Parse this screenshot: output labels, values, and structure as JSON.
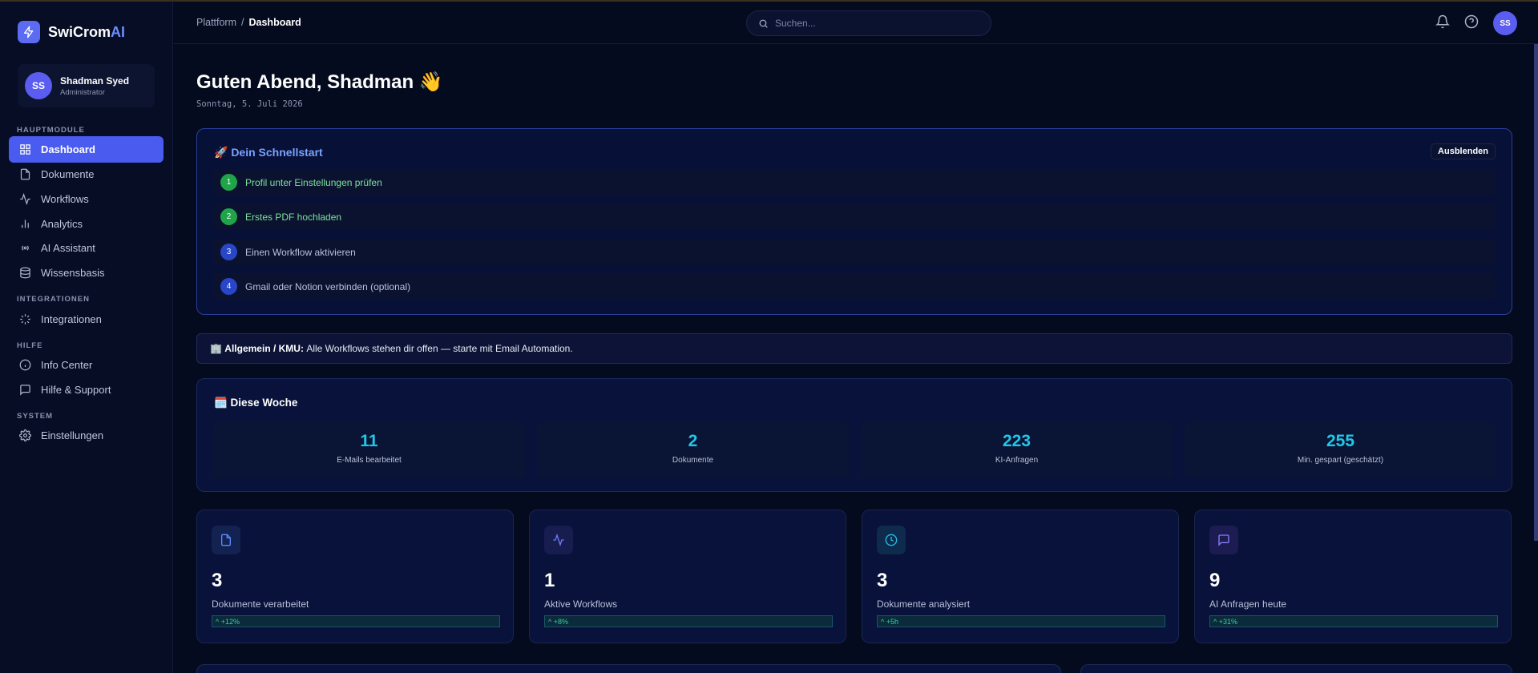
{
  "brand": {
    "name_main": "SwiCrom",
    "name_accent": "AI",
    "accent_color": "#6c8dff"
  },
  "user": {
    "initials": "SS",
    "name": "Shadman Syed",
    "role": "Administrator"
  },
  "sidebar": {
    "sections": [
      {
        "label": "HAUPTMODULE"
      },
      {
        "label": "INTEGRATIONEN"
      },
      {
        "label": "HILFE"
      },
      {
        "label": "SYSTEM"
      }
    ],
    "items": [
      {
        "label": "Dashboard",
        "icon": "grid-icon",
        "active": true
      },
      {
        "label": "Dokumente",
        "icon": "document-icon"
      },
      {
        "label": "Workflows",
        "icon": "activity-icon"
      },
      {
        "label": "Analytics",
        "icon": "bar-chart-icon"
      },
      {
        "label": "AI Assistant",
        "icon": "radio-icon"
      },
      {
        "label": "Wissensbasis",
        "icon": "database-icon"
      },
      {
        "label": "Integrationen",
        "icon": "loader-icon"
      },
      {
        "label": "Info Center",
        "icon": "info-icon"
      },
      {
        "label": "Hilfe & Support",
        "icon": "message-square-icon"
      },
      {
        "label": "Einstellungen",
        "icon": "gear-icon"
      }
    ]
  },
  "topbar": {
    "breadcrumb": {
      "root": "Plattform",
      "separator": "/",
      "current": "Dashboard"
    },
    "search_placeholder": "Suchen...",
    "avatar_initials": "SS"
  },
  "main": {
    "greeting": "Guten Abend, Shadman 👋",
    "date": "Sonntag, 5. Juli 2026",
    "quickstart": {
      "title": "🚀 Dein Schnellstart",
      "hide_label": "Ausblenden",
      "steps": [
        {
          "num": "1",
          "text": "Profil unter Einstellungen prüfen",
          "done": true
        },
        {
          "num": "2",
          "text": "Erstes PDF hochladen",
          "done": true
        },
        {
          "num": "3",
          "text": "Einen Workflow aktivieren",
          "done": false
        },
        {
          "num": "4",
          "text": "Gmail oder Notion verbinden (optional)",
          "done": false
        }
      ]
    },
    "banner": {
      "emoji": "🏢",
      "bold": "Allgemein / KMU:",
      "text": "Alle Workflows stehen dir offen — starte mit Email Automation."
    },
    "week": {
      "title": "🗓️ Diese Woche",
      "stats": [
        {
          "value": "11",
          "label": "E-Mails bearbeitet"
        },
        {
          "value": "2",
          "label": "Dokumente"
        },
        {
          "value": "223",
          "label": "KI-Anfragen"
        },
        {
          "value": "255",
          "label": "Min. gespart (geschätzt)"
        }
      ]
    },
    "kpis": [
      {
        "icon": "file-icon",
        "value": "3",
        "label": "Dokumente verarbeitet",
        "trend": "^ +12%"
      },
      {
        "icon": "activity-icon",
        "value": "1",
        "label": "Aktive Workflows",
        "trend": "^ +8%"
      },
      {
        "icon": "clock-icon",
        "value": "3",
        "label": "Dokumente analysiert",
        "trend": "^ +5h"
      },
      {
        "icon": "chat-icon",
        "value": "9",
        "label": "AI Anfragen heute",
        "trend": "^ +31%"
      }
    ]
  }
}
